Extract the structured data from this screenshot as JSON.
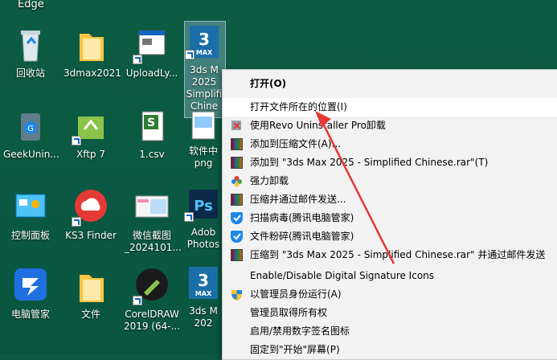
{
  "top_label": "Edge",
  "desktop_icons": [
    {
      "label": "回收站"
    },
    {
      "label": "3dmax2021"
    },
    {
      "label": "UploadLy..."
    },
    {
      "label": "3ds M\n2025\nSimplifi\nChine"
    },
    {
      "label": "GeekUnin..."
    },
    {
      "label": "Xftp 7"
    },
    {
      "label": "1.csv"
    },
    {
      "label": "软件中\npng"
    },
    {
      "label": "控制面板"
    },
    {
      "label": "KS3 Finder"
    },
    {
      "label": "微信截图\n_2024101..."
    },
    {
      "label": "Adob\nPhotos"
    },
    {
      "label": "电脑管家"
    },
    {
      "label": "文件"
    },
    {
      "label": "CorelDRAW\n2019 (64-..."
    },
    {
      "label": "3ds M\n202"
    }
  ],
  "context_menu": {
    "items": [
      {
        "label": "打开(O)",
        "icon": "none"
      },
      {
        "label": "打开文件所在的位置(I)",
        "icon": "none"
      },
      {
        "label": "使用Revo Uninstaller Pro卸载",
        "icon": "revo-icon"
      },
      {
        "label": "添加到压缩文件(A)...",
        "icon": "rar-icon"
      },
      {
        "label": "添加到 \"3ds Max 2025 - Simplified Chinese.rar\"(T)",
        "icon": "rar-icon"
      },
      {
        "label": "强力卸载",
        "icon": "flower-icon"
      },
      {
        "label": "压缩并通过邮件发送...",
        "icon": "rar-icon"
      },
      {
        "label": "扫描病毒(腾讯电脑管家)",
        "icon": "shield-icon"
      },
      {
        "label": "文件粉碎(腾讯电脑管家)",
        "icon": "shield-icon"
      },
      {
        "label": "压缩到 \"3ds Max 2025 - Simplified Chinese.rar\" 并通过邮件发送",
        "icon": "rar-icon"
      },
      {
        "label": "Enable/Disable Digital Signature Icons",
        "icon": "none"
      },
      {
        "label": "以管理员身份运行(A)",
        "icon": "uac-shield-icon"
      },
      {
        "label": "管理员取得所有权",
        "icon": "none"
      },
      {
        "label": "启用/禁用数字签名图标",
        "icon": "none"
      },
      {
        "label": "固定到\"开始\"屏幕(P)",
        "icon": "none"
      }
    ]
  },
  "colors": {
    "desktop_bg": "#0b5a42",
    "menu_bg": "#f2f2f2",
    "highlight": "#ffffff",
    "arrow": "#e53935"
  }
}
